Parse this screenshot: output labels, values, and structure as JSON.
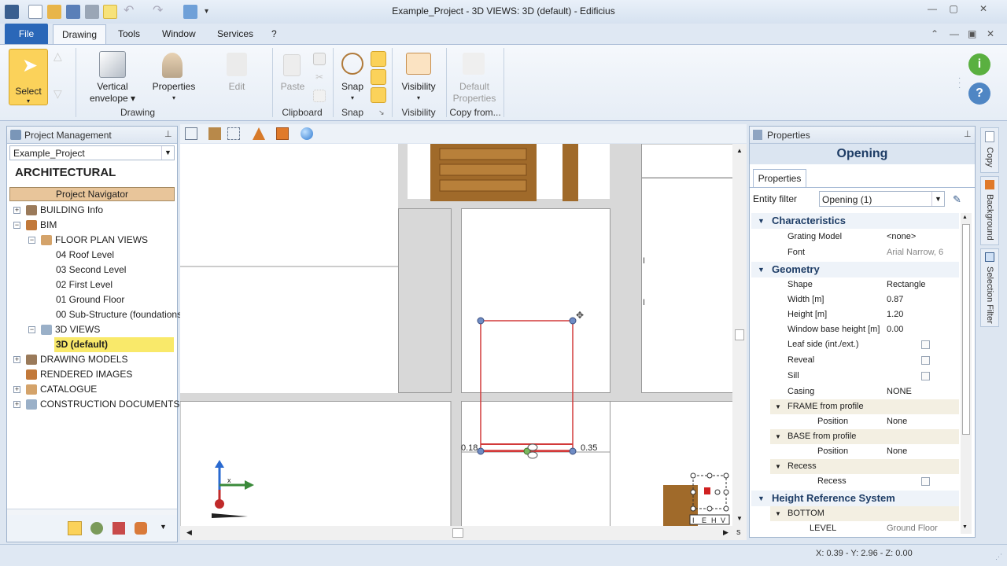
{
  "window": {
    "title": "Example_Project - 3D VIEWS: 3D (default) - Edificius"
  },
  "menu": {
    "file": "File",
    "items": [
      "Drawing",
      "Tools",
      "Window",
      "Services",
      "?"
    ]
  },
  "ribbon": {
    "select": "Select",
    "vertical_envelope": "Vertical envelope",
    "properties": "Properties",
    "edit": "Edit",
    "paste": "Paste",
    "snap": "Snap",
    "visibility": "Visibility",
    "default_properties": "Default Properties",
    "groups": {
      "drawing": "Drawing",
      "clipboard": "Clipboard",
      "snap": "Snap",
      "visibility": "Visibility",
      "copy_from": "Copy from..."
    }
  },
  "project_panel": {
    "title": "Project Management",
    "project_select": "Example_Project",
    "section": "ARCHITECTURAL",
    "navigator": "Project Navigator",
    "tree": [
      {
        "label": "BUILDING Info",
        "level": 0,
        "expander": "+"
      },
      {
        "label": "BIM",
        "level": 0,
        "expander": "−"
      },
      {
        "label": "FLOOR PLAN VIEWS",
        "level": 1,
        "expander": "−"
      },
      {
        "label": "04 Roof Level",
        "level": 2,
        "expander": ""
      },
      {
        "label": "03 Second Level",
        "level": 2,
        "expander": ""
      },
      {
        "label": "02 First Level",
        "level": 2,
        "expander": ""
      },
      {
        "label": "01 Ground Floor",
        "level": 2,
        "expander": ""
      },
      {
        "label": "00 Sub-Structure (foundations)",
        "level": 2,
        "expander": ""
      },
      {
        "label": "3D VIEWS",
        "level": 1,
        "expander": "−"
      },
      {
        "label": "3D (default)",
        "level": 2,
        "expander": "",
        "selected": true
      },
      {
        "label": "DRAWING MODELS",
        "level": 0,
        "expander": "+"
      },
      {
        "label": "RENDERED IMAGES",
        "level": 0,
        "expander": ""
      },
      {
        "label": "CATALOGUE",
        "level": 0,
        "expander": "+"
      },
      {
        "label": "CONSTRUCTION DOCUMENTS SET",
        "level": 0,
        "expander": "+"
      }
    ]
  },
  "viewport": {
    "dim_left": "0.18",
    "dim_right": "0.35",
    "cube_labels": [
      "I",
      "E",
      "H",
      "V"
    ],
    "scroll_corner": "s"
  },
  "properties_panel": {
    "title": "Properties",
    "object": "Opening",
    "tab": "Properties",
    "entity_filter_label": "Entity filter",
    "entity_filter_value": "Opening (1)",
    "sections": {
      "characteristics": "Characteristics",
      "geometry": "Geometry",
      "height_ref": "Height Reference System"
    },
    "rows": {
      "grating_model": [
        "Grating Model",
        "<none>"
      ],
      "font": [
        "Font",
        "Arial Narrow, 6"
      ],
      "shape": [
        "Shape",
        "Rectangle"
      ],
      "width": [
        "Width  [m]",
        "0.87"
      ],
      "height": [
        "Height  [m]",
        "1.20"
      ],
      "window_base": [
        "Window base height  [m]",
        "0.00"
      ],
      "leaf_side": [
        "Leaf side (int./ext.)",
        ""
      ],
      "reveal": [
        "Reveal",
        ""
      ],
      "sill": [
        "Sill",
        ""
      ],
      "casing": [
        "Casing",
        "NONE"
      ],
      "frame_position": [
        "Position",
        "None"
      ],
      "base_position": [
        "Position",
        "None"
      ],
      "recess": [
        "Recess",
        ""
      ],
      "level": [
        "LEVEL",
        "Ground Floor"
      ]
    },
    "subsections": {
      "frame": "FRAME from profile",
      "base": "BASE from profile",
      "recess": "Recess",
      "bottom": "BOTTOM"
    }
  },
  "side_tabs": [
    "Copy",
    "Background",
    "Selection Filter"
  ],
  "status": {
    "coords": "X: 0.39 - Y: 2.96 - Z: 0.00"
  },
  "colors": {
    "accent": "#2a67b8",
    "selection": "#f9e96a",
    "navigator": "#e8c59a",
    "opening": "#d23a3a"
  }
}
